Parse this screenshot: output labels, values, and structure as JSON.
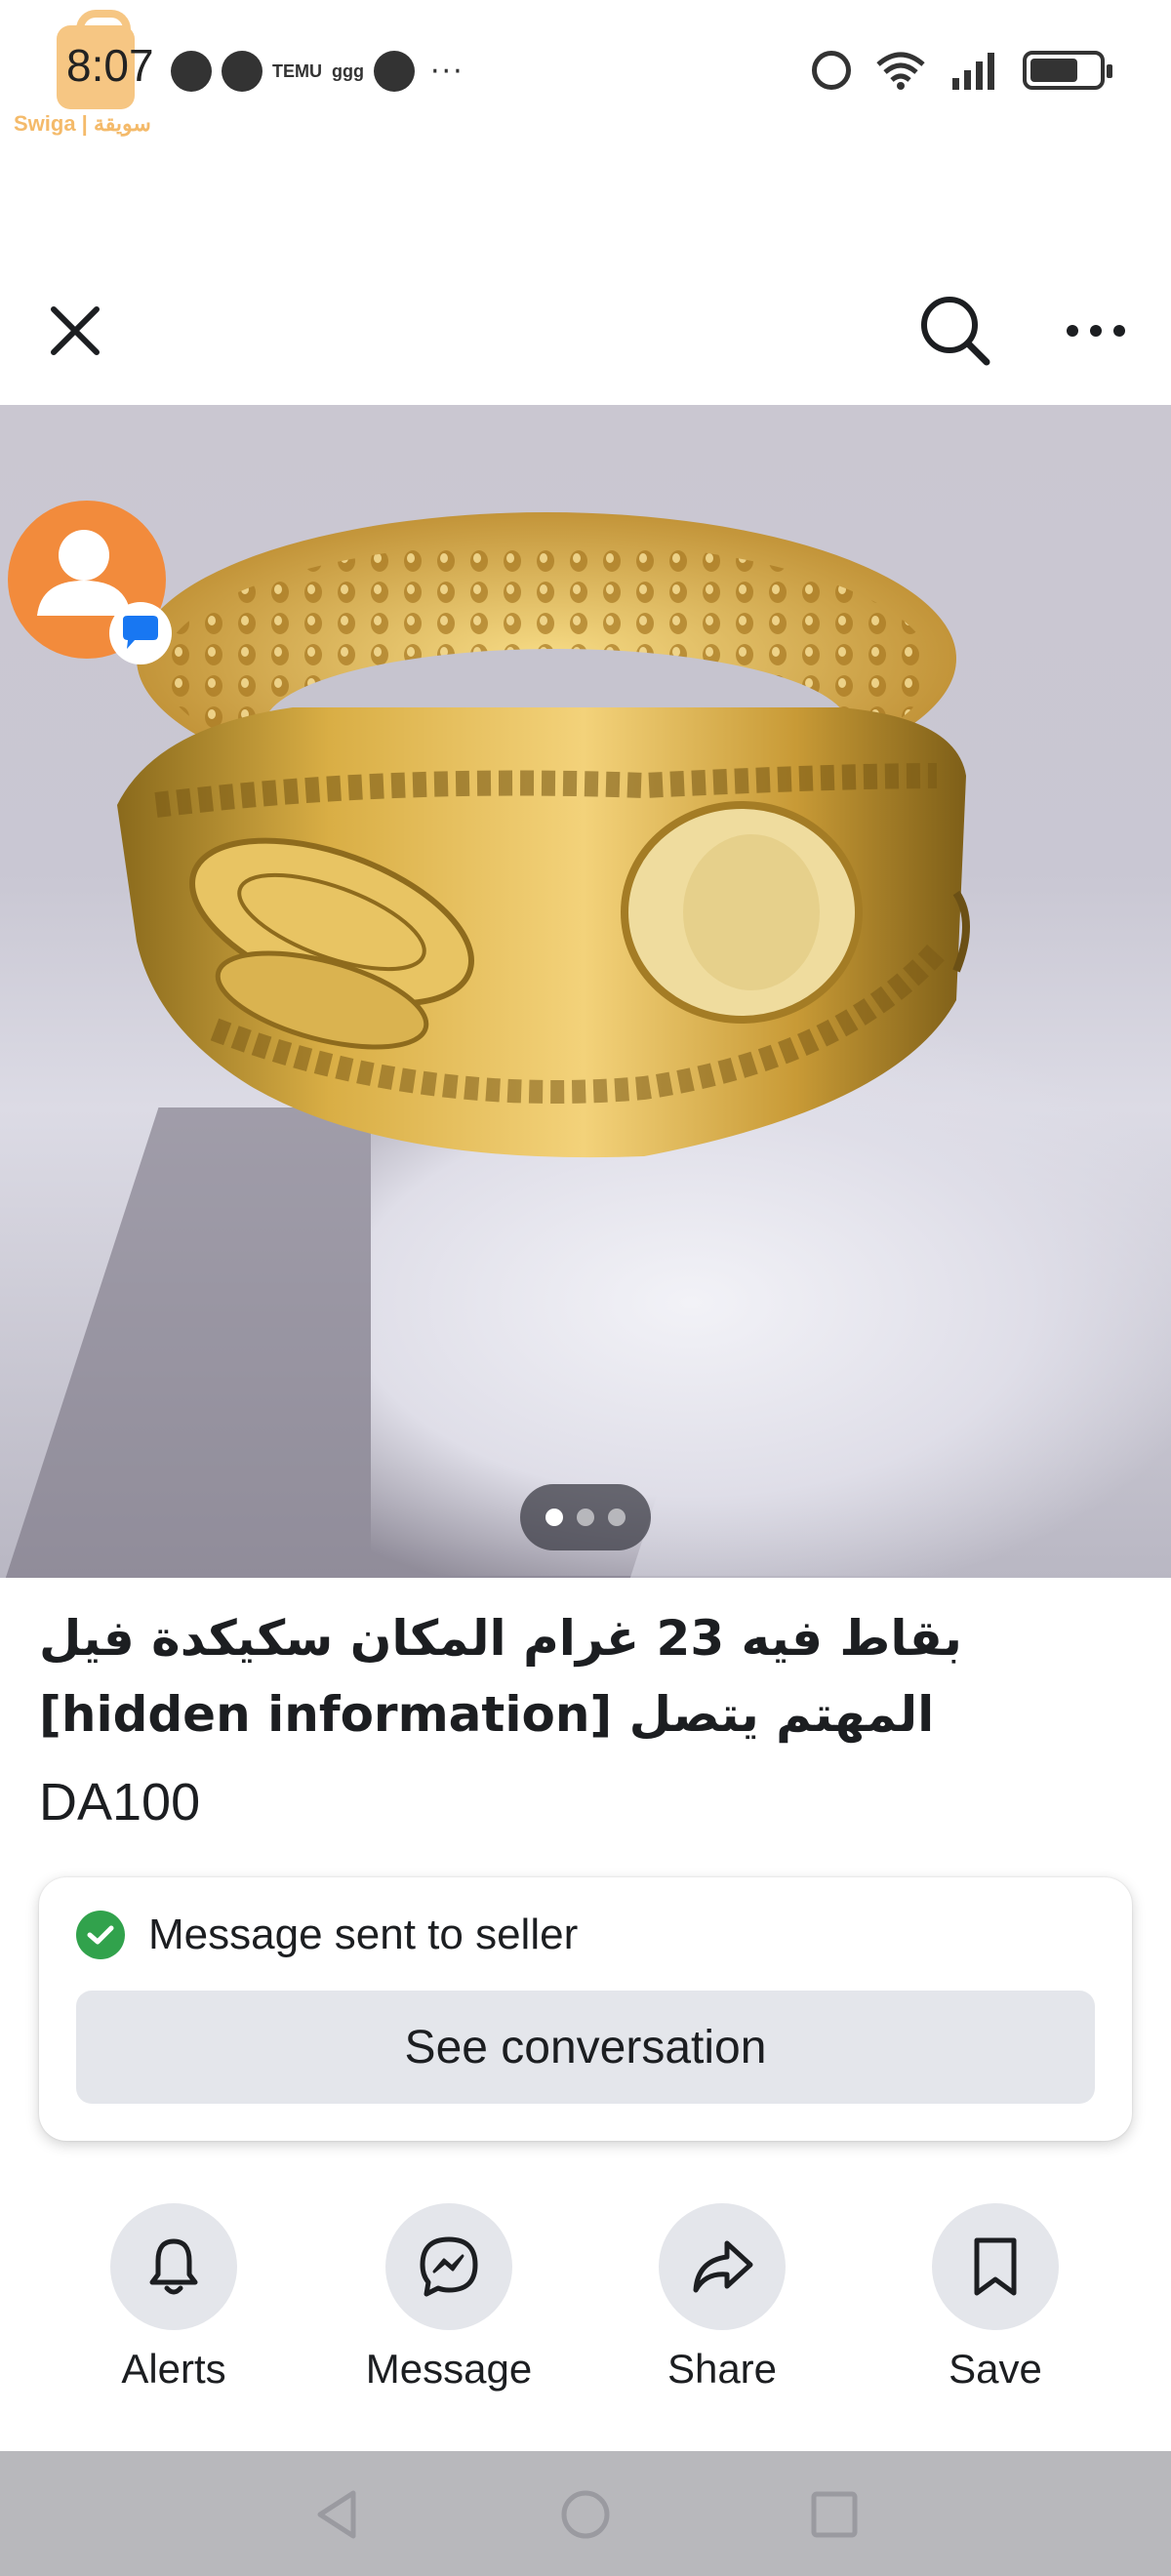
{
  "status_bar": {
    "time": "8:07",
    "watermark_text": "Swiga | سويقة",
    "notification_icons": [
      "messenger-icon",
      "chat-bubble-icon",
      "temu-icon",
      "threads-icon",
      "more-dots-icon"
    ],
    "temu_label": "TEMU",
    "threads_label": "ggg",
    "overflow": "···",
    "battery_level": 0.7
  },
  "top_bar": {
    "close_icon": "close-icon",
    "search_icon": "search-icon",
    "more_icon": "more-icon"
  },
  "photo": {
    "page_count": 3,
    "active_page": 1
  },
  "listing": {
    "title": "بقاط فيه 23 غرام المكان سكيكدة فيل المهتم يتصل [hidden information]",
    "price": "DA100"
  },
  "message_card": {
    "status_text": "Message sent to seller",
    "button_label": "See conversation",
    "accent_color": "#31a24c"
  },
  "actions": [
    {
      "label": "Alerts",
      "icon": "bell-icon"
    },
    {
      "label": "Message",
      "icon": "messenger-icon"
    },
    {
      "label": "Share",
      "icon": "share-icon"
    },
    {
      "label": "Save",
      "icon": "bookmark-icon"
    }
  ],
  "nav_bar": {
    "back_icon": "back-icon",
    "home_icon": "home-icon",
    "recents_icon": "recents-icon"
  }
}
